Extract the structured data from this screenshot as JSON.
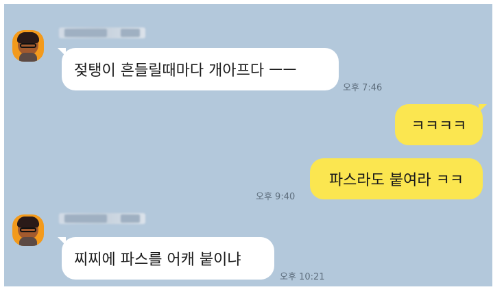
{
  "colors": {
    "chat_background": "#b3c8db",
    "incoming_bubble": "#ffffff",
    "outgoing_bubble": "#fbe650",
    "avatar_background": "#f39a1c",
    "timestamp_text": "#5d6d7c"
  },
  "messages": [
    {
      "direction": "incoming",
      "sender_name_visible": "blurred",
      "text": "젖탱이 흔들릴때마다 개아프다 ㅡㅡ",
      "time": "오후 7:46"
    },
    {
      "direction": "outgoing",
      "text": "ㅋㅋㅋㅋ",
      "time": ""
    },
    {
      "direction": "outgoing",
      "text": "파스라도 붙여라 ㅋㅋ",
      "time": "오후 9:40"
    },
    {
      "direction": "incoming",
      "sender_name_visible": "blurred",
      "text": "찌찌에 파스를 어캐 붙이냐",
      "time": "오후 10:21"
    }
  ]
}
